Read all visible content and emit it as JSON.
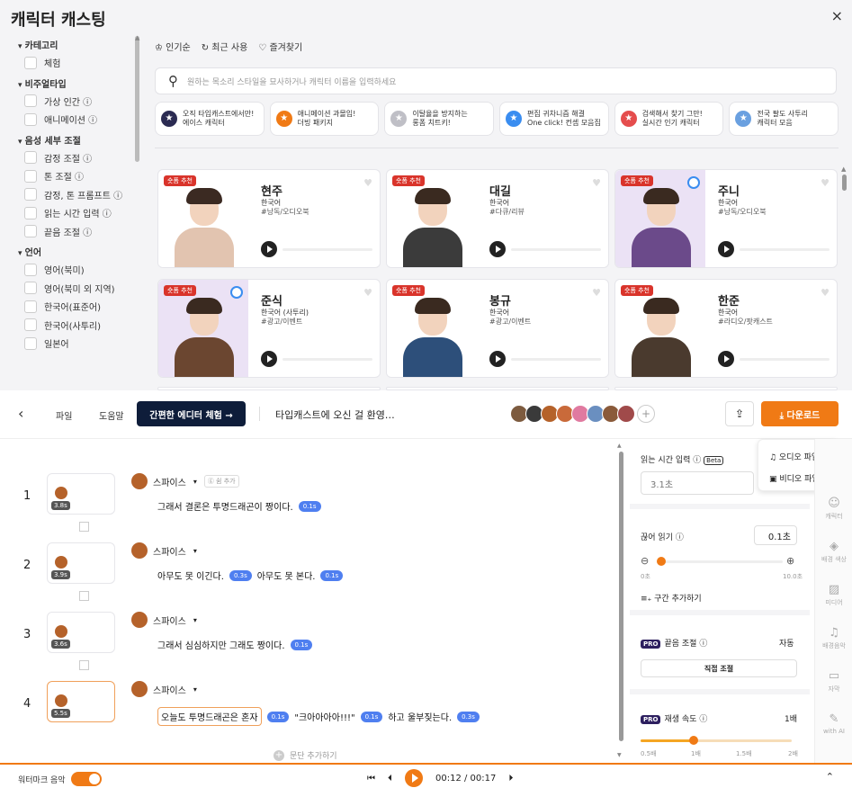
{
  "modal": {
    "title": "캐릭터 캐스팅",
    "close": "×",
    "sidebar": {
      "cat": "카테고리",
      "cat_items": [
        "체험"
      ],
      "nonmember": "비주얼타입",
      "nonmember_items": [
        "가상 인간 ⓘ",
        "애니메이션 ⓘ"
      ],
      "voice": "음성 세부 조절",
      "voice_items": [
        "감정 조절 ⓘ",
        "톤 조절 ⓘ",
        "감정, 톤 프롬프트 ⓘ",
        "읽는 시간 입력 ⓘ",
        "끝음 조절 ⓘ"
      ],
      "lang": "언어",
      "lang_items": [
        "영어(북미)",
        "영어(북미 외 지역)",
        "한국어(표준어)",
        "한국어(사투리)",
        "일본어"
      ]
    },
    "sort": [
      "♔ 인기순",
      "↻ 최근 사용",
      "♡ 즐겨찾기"
    ],
    "search_placeholder": "원하는 목소리 스타일을 묘사하거나 캐릭터 이름을 입력하세요",
    "chips": [
      {
        "l1": "오직 타입캐스트에서만!",
        "l2": "에이스 캐릭터",
        "color": "#2b2b52"
      },
      {
        "l1": "애니메이션 과몰입!",
        "l2": "더빙 패키지",
        "color": "#f07a15"
      },
      {
        "l1": "이탈율을 방지하는",
        "l2": "롱폼 치트키!",
        "color": "#bfbfc6"
      },
      {
        "l1": "편집 귀차니즘 해결",
        "l2": "One click! 컨셉 모음집",
        "color": "#3a8df0"
      },
      {
        "l1": "검색해서 찾기 그만!",
        "l2": "실시간 인기 캐릭터",
        "color": "#e54d4d"
      },
      {
        "l1": "전국 팔도 사투리",
        "l2": "캐릭터 모음",
        "color": "#6aa0e0"
      }
    ],
    "badge": "숏폼 추천",
    "cards": [
      {
        "name": "현주",
        "lang": "한국어",
        "tag": "#낭독/오디오북",
        "bg": "#ffffff",
        "fig": "#e2c4b0",
        "verified": false
      },
      {
        "name": "대길",
        "lang": "한국어",
        "tag": "#다큐/리뷰",
        "bg": "#ffffff",
        "fig": "#3b3b3b",
        "verified": false
      },
      {
        "name": "주니",
        "lang": "한국어",
        "tag": "#낭독/오디오북",
        "bg": "#ebe2f5",
        "fig": "#6b4a8a",
        "verified": true
      },
      {
        "name": "준식",
        "lang": "한국어 (사투리)",
        "tag": "#광고/이벤트",
        "bg": "#ebe2f5",
        "fig": "#6b4630",
        "verified": true
      },
      {
        "name": "봉규",
        "lang": "한국어",
        "tag": "#광고/이벤트",
        "bg": "#ffffff",
        "fig": "#2d4f7a",
        "verified": false
      },
      {
        "name": "한준",
        "lang": "한국어",
        "tag": "#라디오/팟캐스트",
        "bg": "#ffffff",
        "fig": "#4a3a2e",
        "verified": false
      }
    ]
  },
  "toolbar": {
    "back": "‹",
    "file": "파일",
    "help": "도움말",
    "try": "간편한 에디터 체험 →",
    "doc": "타입캐스트에 오신 걸 환영…",
    "plus": "+",
    "share": "⇪",
    "download": "⤓ 다운로드"
  },
  "menu": {
    "audio": "♫ 오디오 파일",
    "video": "▣ 비디오 파일"
  },
  "rows": [
    {
      "num": "1",
      "dur": "3.8s",
      "speaker": "스파이스",
      "add": "ⓖ 쉼 추가",
      "parts": [
        {
          "t": "그래서 결론은 투명드래곤이 짱이다."
        },
        {
          "p": "0.1s"
        }
      ]
    },
    {
      "num": "2",
      "dur": "3.9s",
      "speaker": "스파이스",
      "add": "",
      "parts": [
        {
          "t": "아무도 못 이긴다."
        },
        {
          "p": "0.3s"
        },
        {
          "t": "아무도 못 본다."
        },
        {
          "p": "0.1s"
        }
      ]
    },
    {
      "num": "3",
      "dur": "3.6s",
      "speaker": "스파이스",
      "add": "",
      "parts": [
        {
          "t": "그래서 심심하지만 그래도 짱이다."
        },
        {
          "p": "0.1s"
        }
      ]
    },
    {
      "num": "4",
      "dur": "5.5s",
      "speaker": "스파이스",
      "add": "",
      "parts": [
        {
          "h": "오늘도 투명드래곤은 혼자"
        },
        {
          "p": "0.1s"
        },
        {
          "t": "\"크아아아아!!!\""
        },
        {
          "p": "0.1s"
        },
        {
          "t": "하고 울부짖는다."
        },
        {
          "p": "0.3s"
        }
      ]
    }
  ],
  "add_segment": "문단 추가하기",
  "panel": {
    "read_label": "읽는 시간 입력 ⓘ",
    "beta": "Beta",
    "read_val": "3.1초",
    "pause_label": "끊어 읽기 ⓘ",
    "pause_val": "0.1초",
    "pause_min": "0초",
    "pause_max": "10.0초",
    "add_range": "≡₊ 구간 추가하기",
    "pro": "PRO",
    "end_label": "끝음 조절 ⓘ",
    "end_val": "자동",
    "end_btn": "직접 조절",
    "speed_label": "재생 속도 ⓘ",
    "speed_val": "1배",
    "speed_ticks": [
      "0.5배",
      "1배",
      "1.5배",
      "2배"
    ]
  },
  "rail": [
    "캐릭터",
    "배경 색상",
    "미디어",
    "배경음악",
    "자막",
    "with AI"
  ],
  "bottom": {
    "watermark": "워터마크 음악",
    "time": "00:12 / 00:17"
  }
}
